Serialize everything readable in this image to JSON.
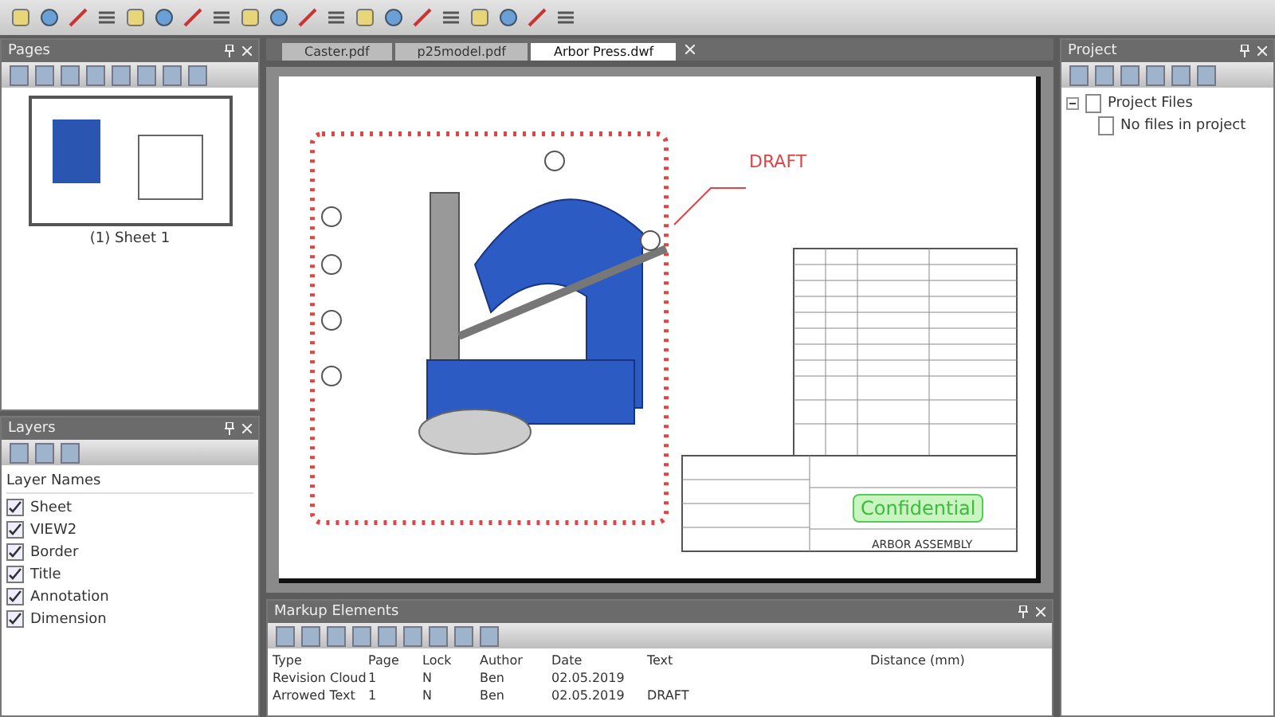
{
  "pages_panel": {
    "title": "Pages",
    "thumbnails": [
      {
        "label": "(1) Sheet 1",
        "selected": true
      }
    ]
  },
  "layers_panel": {
    "title": "Layers",
    "header": "Layer Names",
    "layers": [
      {
        "name": "Sheet",
        "checked": true
      },
      {
        "name": "VIEW2",
        "checked": true
      },
      {
        "name": "Border",
        "checked": true
      },
      {
        "name": "Title",
        "checked": true
      },
      {
        "name": "Annotation",
        "checked": true
      },
      {
        "name": "Dimension",
        "checked": true
      }
    ]
  },
  "tabs": [
    {
      "label": "Caster.pdf",
      "selected": false
    },
    {
      "label": "p25model.pdf",
      "selected": false
    },
    {
      "label": "Arbor Press.dwf",
      "selected": true
    }
  ],
  "drawing": {
    "markup_text": "DRAFT",
    "stamp": "Confidential",
    "title": "ARBOR ASSEMBLY"
  },
  "markup_panel": {
    "title": "Markup Elements",
    "columns": [
      "Type",
      "Page",
      "Lock",
      "Author",
      "Date",
      "Text",
      "Distance (mm)"
    ],
    "rows": [
      [
        "Revision Cloud",
        "1",
        "N",
        "Ben",
        "02.05.2019",
        ""
      ],
      [
        "Arrowed Text",
        "1",
        "N",
        "Ben",
        "02.05.2019",
        "DRAFT"
      ]
    ]
  },
  "project_panel": {
    "title": "Project",
    "tree": [
      {
        "label": "Project Files",
        "expanded": true,
        "children": [
          {
            "label": "No files in project"
          }
        ]
      }
    ]
  }
}
